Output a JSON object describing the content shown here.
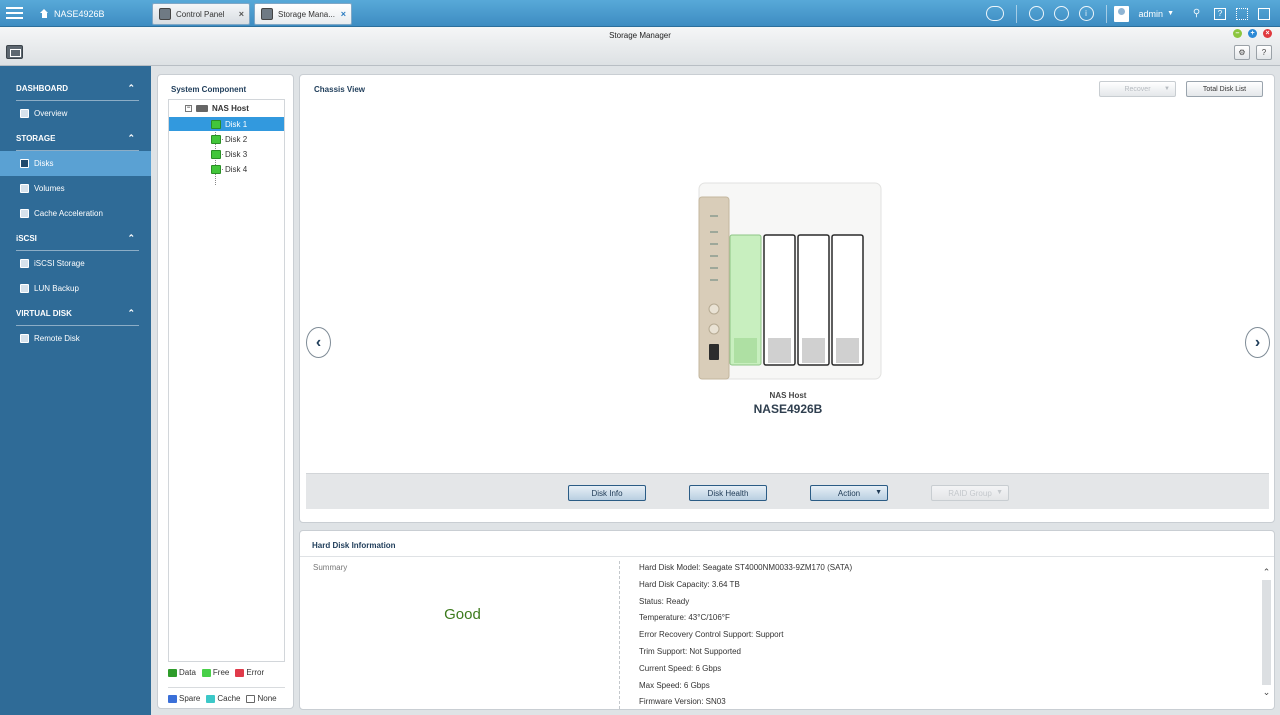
{
  "topbar": {
    "host_name": "NASE4926B",
    "tabs": [
      {
        "label": "Control Panel"
      },
      {
        "label": "Storage Mana..."
      }
    ],
    "close_glyph": "×",
    "user": "admin"
  },
  "window": {
    "title": "Storage Manager"
  },
  "sidebar": {
    "groups": [
      {
        "label": "DASHBOARD",
        "items": [
          {
            "label": "Overview"
          }
        ]
      },
      {
        "label": "STORAGE",
        "items": [
          {
            "label": "Disks"
          },
          {
            "label": "Volumes"
          },
          {
            "label": "Cache Acceleration"
          }
        ]
      },
      {
        "label": "iSCSI",
        "items": [
          {
            "label": "iSCSI Storage"
          },
          {
            "label": "LUN Backup"
          }
        ]
      },
      {
        "label": "VIRTUAL DISK",
        "items": [
          {
            "label": "Remote Disk"
          }
        ]
      }
    ]
  },
  "component_panel": {
    "title": "System Component",
    "host_label": "NAS Host",
    "disks": [
      {
        "label": "Disk 1"
      },
      {
        "label": "Disk 2"
      },
      {
        "label": "Disk 3"
      },
      {
        "label": "Disk 4"
      }
    ],
    "legend": [
      {
        "label": "Data",
        "color": "#2e9c2a"
      },
      {
        "label": "Free",
        "color": "#48d048"
      },
      {
        "label": "Error",
        "color": "#e03a4a"
      },
      {
        "label": "Spare",
        "color": "#3a6fd8"
      },
      {
        "label": "Cache",
        "color": "#3cc8c8"
      },
      {
        "label": "None",
        "color": "#ffffff"
      }
    ]
  },
  "chassis": {
    "title": "Chassis View",
    "recover_label": "Recover",
    "total_disk_list_label": "Total Disk List",
    "prev_glyph": "‹",
    "next_glyph": "›",
    "host_label": "NAS Host",
    "host_name": "NASE4926B",
    "actions": {
      "disk_info": "Disk Info",
      "disk_health": "Disk Health",
      "action": "Action",
      "raid_group": "RAID Group"
    }
  },
  "info": {
    "title": "Hard Disk Information",
    "summary_label": "Summary",
    "summary_status": "Good",
    "details": [
      "Hard Disk Model: Seagate ST4000NM0033-9ZM170 (SATA)",
      "Hard Disk Capacity: 3.64 TB",
      "Status: Ready",
      "Temperature: 43°C/106°F",
      "Error Recovery Control Support: Support",
      "Trim Support: Not Supported",
      "Current Speed: 6 Gbps",
      "Max Speed: 6 Gbps",
      "Firmware Version: SN03"
    ]
  },
  "colors": {
    "accent": "#3d8cc2",
    "sidebar": "#2f6b97",
    "selected": "#3299de",
    "good": "#3c7a1c"
  }
}
